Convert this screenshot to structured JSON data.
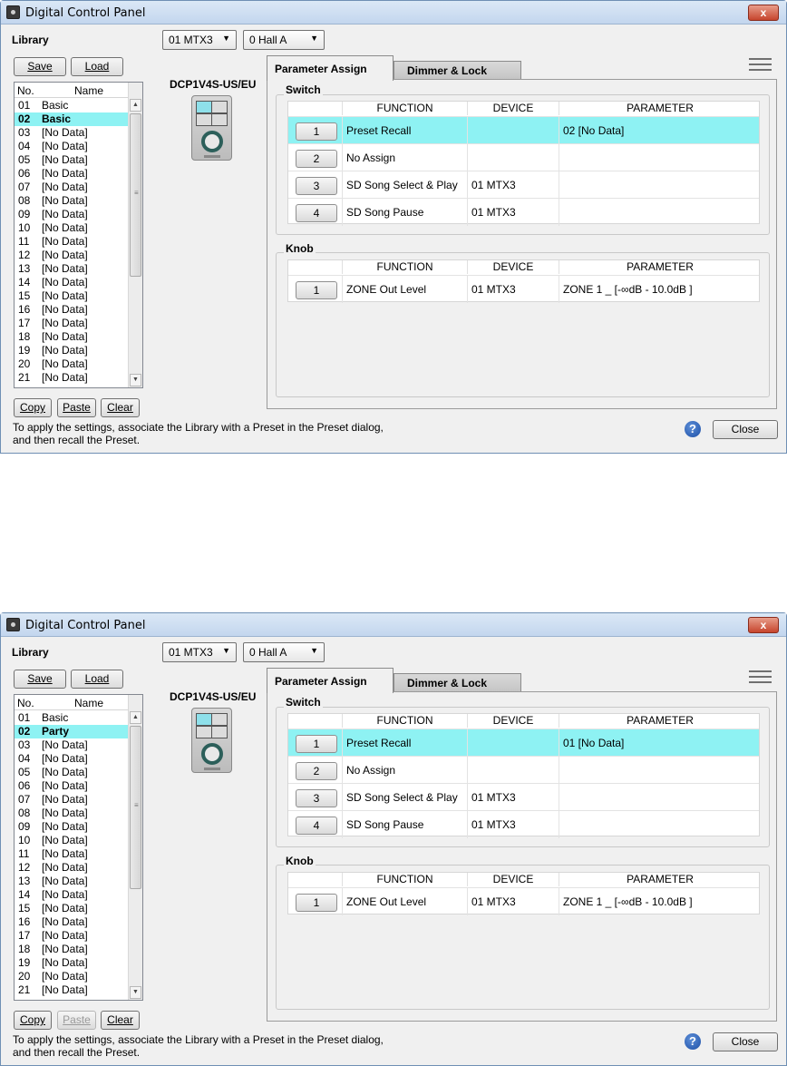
{
  "panels": [
    {
      "title": "Digital Control Panel",
      "close_x": "x",
      "library_label": "Library",
      "device_select": "01 MTX3",
      "preset_select": "0 Hall A",
      "save_label": "Save",
      "load_label": "Load",
      "list_header_no": "No.",
      "list_header_name": "Name",
      "library_items": [
        {
          "no": "01",
          "name": "Basic"
        },
        {
          "no": "02",
          "name": "Basic"
        },
        {
          "no": "03",
          "name": "[No Data]"
        },
        {
          "no": "04",
          "name": "[No Data]"
        },
        {
          "no": "05",
          "name": "[No Data]"
        },
        {
          "no": "06",
          "name": "[No Data]"
        },
        {
          "no": "07",
          "name": "[No Data]"
        },
        {
          "no": "08",
          "name": "[No Data]"
        },
        {
          "no": "09",
          "name": "[No Data]"
        },
        {
          "no": "10",
          "name": "[No Data]"
        },
        {
          "no": "11",
          "name": "[No Data]"
        },
        {
          "no": "12",
          "name": "[No Data]"
        },
        {
          "no": "13",
          "name": "[No Data]"
        },
        {
          "no": "14",
          "name": "[No Data]"
        },
        {
          "no": "15",
          "name": "[No Data]"
        },
        {
          "no": "16",
          "name": "[No Data]"
        },
        {
          "no": "17",
          "name": "[No Data]"
        },
        {
          "no": "18",
          "name": "[No Data]"
        },
        {
          "no": "19",
          "name": "[No Data]"
        },
        {
          "no": "20",
          "name": "[No Data]"
        },
        {
          "no": "21",
          "name": "[No Data]"
        }
      ],
      "copy_label": "Copy",
      "paste_label": "Paste",
      "paste_enabled": true,
      "clear_label": "Clear",
      "device_model": "DCP1V4S-US/EU",
      "tab_parameter": "Parameter Assign",
      "tab_dimmer": "Dimmer & Lock",
      "switch_group": "Switch",
      "knob_group": "Knob",
      "col_function": "FUNCTION",
      "col_device": "DEVICE",
      "col_parameter": "PARAMETER",
      "switch_rows": [
        {
          "num": "1",
          "function": "Preset Recall",
          "device": "",
          "parameter": "02 [No Data]"
        },
        {
          "num": "2",
          "function": "No Assign",
          "device": "",
          "parameter": ""
        },
        {
          "num": "3",
          "function": "SD Song Select & Play",
          "device": "01 MTX3",
          "parameter": ""
        },
        {
          "num": "4",
          "function": "SD Song Pause",
          "device": "01 MTX3",
          "parameter": ""
        }
      ],
      "knob_rows": [
        {
          "num": "1",
          "function": "ZONE Out Level",
          "device": "01 MTX3",
          "parameter": "ZONE 1 _ [-∞dB - 10.0dB ]"
        }
      ],
      "footer_line1": "To apply the settings, associate the Library with a Preset in the Preset dialog,",
      "footer_line2": "and then recall the Preset.",
      "help_glyph": "?",
      "close_label": "Close"
    },
    {
      "title": "Digital Control Panel",
      "close_x": "x",
      "library_label": "Library",
      "device_select": "01 MTX3",
      "preset_select": "0 Hall A",
      "save_label": "Save",
      "load_label": "Load",
      "list_header_no": "No.",
      "list_header_name": "Name",
      "library_items": [
        {
          "no": "01",
          "name": "Basic"
        },
        {
          "no": "02",
          "name": "Party"
        },
        {
          "no": "03",
          "name": "[No Data]"
        },
        {
          "no": "04",
          "name": "[No Data]"
        },
        {
          "no": "05",
          "name": "[No Data]"
        },
        {
          "no": "06",
          "name": "[No Data]"
        },
        {
          "no": "07",
          "name": "[No Data]"
        },
        {
          "no": "08",
          "name": "[No Data]"
        },
        {
          "no": "09",
          "name": "[No Data]"
        },
        {
          "no": "10",
          "name": "[No Data]"
        },
        {
          "no": "11",
          "name": "[No Data]"
        },
        {
          "no": "12",
          "name": "[No Data]"
        },
        {
          "no": "13",
          "name": "[No Data]"
        },
        {
          "no": "14",
          "name": "[No Data]"
        },
        {
          "no": "15",
          "name": "[No Data]"
        },
        {
          "no": "16",
          "name": "[No Data]"
        },
        {
          "no": "17",
          "name": "[No Data]"
        },
        {
          "no": "18",
          "name": "[No Data]"
        },
        {
          "no": "19",
          "name": "[No Data]"
        },
        {
          "no": "20",
          "name": "[No Data]"
        },
        {
          "no": "21",
          "name": "[No Data]"
        }
      ],
      "copy_label": "Copy",
      "paste_label": "Paste",
      "paste_enabled": false,
      "clear_label": "Clear",
      "device_model": "DCP1V4S-US/EU",
      "tab_parameter": "Parameter Assign",
      "tab_dimmer": "Dimmer & Lock",
      "switch_group": "Switch",
      "knob_group": "Knob",
      "col_function": "FUNCTION",
      "col_device": "DEVICE",
      "col_parameter": "PARAMETER",
      "switch_rows": [
        {
          "num": "1",
          "function": "Preset Recall",
          "device": "",
          "parameter": "01 [No Data]"
        },
        {
          "num": "2",
          "function": "No Assign",
          "device": "",
          "parameter": ""
        },
        {
          "num": "3",
          "function": "SD Song Select & Play",
          "device": "01 MTX3",
          "parameter": ""
        },
        {
          "num": "4",
          "function": "SD Song Pause",
          "device": "01 MTX3",
          "parameter": ""
        }
      ],
      "knob_rows": [
        {
          "num": "1",
          "function": "ZONE Out Level",
          "device": "01 MTX3",
          "parameter": "ZONE 1 _ [-∞dB - 10.0dB ]"
        }
      ],
      "footer_line1": "To apply the settings, associate the Library with a Preset in the Preset dialog,",
      "footer_line2": "and then recall the Preset.",
      "help_glyph": "?",
      "close_label": "Close"
    }
  ]
}
